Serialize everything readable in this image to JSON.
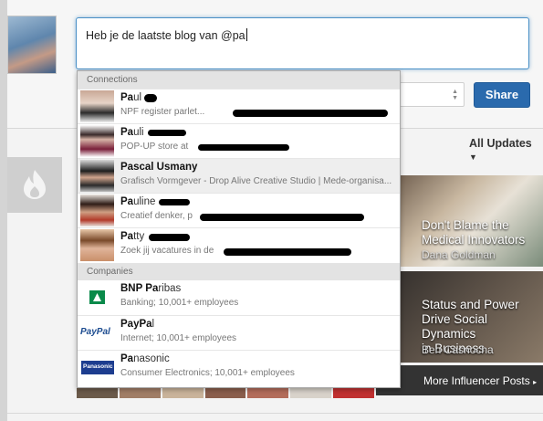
{
  "share": {
    "input_text": "Heb je de laatste blog van @pa",
    "button_label": "Share"
  },
  "feed": {
    "all_updates_label": "All Updates",
    "influencer_posts": [
      {
        "title_lines": [
          "Don't Blame the",
          "Medical Innovators"
        ],
        "author": "Dana Goldman"
      },
      {
        "title_lines": [
          "Status and Power",
          "Drive Social Dynamics",
          "in Business"
        ],
        "author": "Ben Casnocha"
      }
    ],
    "more_link": "More Influencer Posts"
  },
  "mention_dropdown": {
    "connections_header": "Connections",
    "connections": [
      {
        "match": "Pa",
        "rest": "ul",
        "subtitle": "NPF register parlet..."
      },
      {
        "match": "Pa",
        "rest": "uli",
        "subtitle": "POP-UP store at"
      },
      {
        "match": "Pa",
        "rest": "scal Usmany",
        "subtitle": "Grafisch Vormgever - Drop Alive Creative Studio | Mede-organisa..."
      },
      {
        "match": "Pa",
        "rest": "uline",
        "subtitle": "Creatief denker, p"
      },
      {
        "match": "Pa",
        "rest": "tty",
        "subtitle": "Zoek jij vacatures in de"
      }
    ],
    "companies_header": "Companies",
    "companies": [
      {
        "match": "BNP Pa",
        "rest": "ribas",
        "subtitle": "Banking; 10,001+ employees",
        "logo": "BNP"
      },
      {
        "match": "PayPa",
        "rest": "l",
        "subtitle": "Internet; 10,001+ employees",
        "logo": "PayPal"
      },
      {
        "match": "Pa",
        "rest": "nasonic",
        "subtitle": "Consumer Electronics; 10,001+ employees",
        "logo": "Panasonic"
      }
    ]
  },
  "colors": {
    "share_button": "#2a6aad",
    "input_focus": "#4a90c6"
  }
}
